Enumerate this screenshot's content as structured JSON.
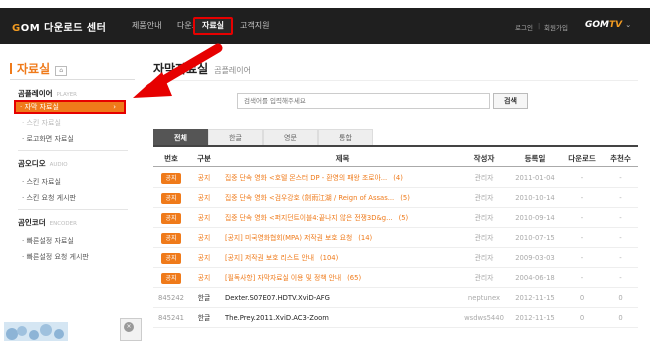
{
  "topnav": {
    "logo_prefix": "G",
    "logo_rest": "OM 다운로드 센터",
    "items": [
      "제품안내",
      "다운로드"
    ],
    "active": "자료실",
    "last": "고객지원",
    "login": "로그인",
    "separator": "|",
    "join": "회원가입",
    "gomtv_prefix": "GOM",
    "gomtv_suffix": "TV",
    "gomtv_caret": "⌄"
  },
  "sidebar": {
    "title": "자료실",
    "title_icon": "home-icon",
    "title_icon_text": "⌂",
    "sections": [
      {
        "label": "곰플레이어",
        "en": "PLAYER",
        "items": [
          "자막 자료실",
          "스킨 자료실",
          "로고화면 자료실"
        ]
      },
      {
        "label": "곰오디오",
        "en": "AUDIO",
        "items": [
          "스킨 자료실",
          "스킨 요청 게시판"
        ]
      },
      {
        "label": "곰인코더",
        "en": "ENCODER",
        "items": [
          "빠른설정 자료실",
          "빠른설정 요청 게시판"
        ]
      }
    ],
    "active_chevron": "›",
    "thumb_close": "×"
  },
  "annotation": {
    "color": "#e60000"
  },
  "main": {
    "title": "자막자료실",
    "subtitle": "곰플레이어",
    "search": {
      "placeholder": "검색어를 입력해주세요",
      "button": "검색"
    },
    "tabs": [
      "전체",
      "한글",
      "영문",
      "통합"
    ],
    "columns": [
      "번호",
      "구분",
      "제목",
      "작성자",
      "등록일",
      "다운로드",
      "추천수"
    ],
    "notice_badge": "공지",
    "rows": [
      {
        "notice": true,
        "cat": "공지",
        "title": "집중 단속 영화 <호텔 몬스터 DP - 환영의 패왕 조로아...",
        "count": "(4)",
        "author": "관리자",
        "date": "2011-01-04",
        "dl": "-",
        "rec": "-"
      },
      {
        "notice": true,
        "cat": "공지",
        "title": "집중 단속 영화 <검우강호 (劍雨江湖 / Reign of Assas...",
        "count": "(5)",
        "author": "관리자",
        "date": "2010-10-14",
        "dl": "-",
        "rec": "-"
      },
      {
        "notice": true,
        "cat": "공지",
        "title": "집중 단속 영화 <퍼지던트이블4:끝나지 않은 전쟁3D&g...",
        "count": "(5)",
        "author": "관리자",
        "date": "2010-09-14",
        "dl": "-",
        "rec": "-"
      },
      {
        "notice": true,
        "cat": "공지",
        "title": "[공지] 미국영화협회(MPA) 저작권 보호 요청",
        "count": "(14)",
        "author": "관리자",
        "date": "2010-07-15",
        "dl": "-",
        "rec": "-"
      },
      {
        "notice": true,
        "cat": "공지",
        "title": "[공지] 저작권 보호 리스트 안내",
        "count": "(104)",
        "author": "관리자",
        "date": "2009-03-03",
        "dl": "-",
        "rec": "-"
      },
      {
        "notice": true,
        "cat": "공지",
        "title": "[필독사항] 자막자료실 이용 및 정책 안내",
        "count": "(65)",
        "author": "관리자",
        "date": "2004-06-18",
        "dl": "-",
        "rec": "-"
      },
      {
        "notice": false,
        "num": "845242",
        "cat": "한글",
        "title": "Dexter.S07E07.HDTV.XviD-AFG",
        "count": "",
        "author": "neptunex",
        "date": "2012-11-15",
        "dl": "0",
        "rec": "0"
      },
      {
        "notice": false,
        "num": "845241",
        "cat": "한글",
        "title": "The.Prey.2011.XviD.AC3-Zoom",
        "count": "",
        "author": "wsdws5440",
        "date": "2012-11-15",
        "dl": "0",
        "rec": "0"
      }
    ]
  }
}
